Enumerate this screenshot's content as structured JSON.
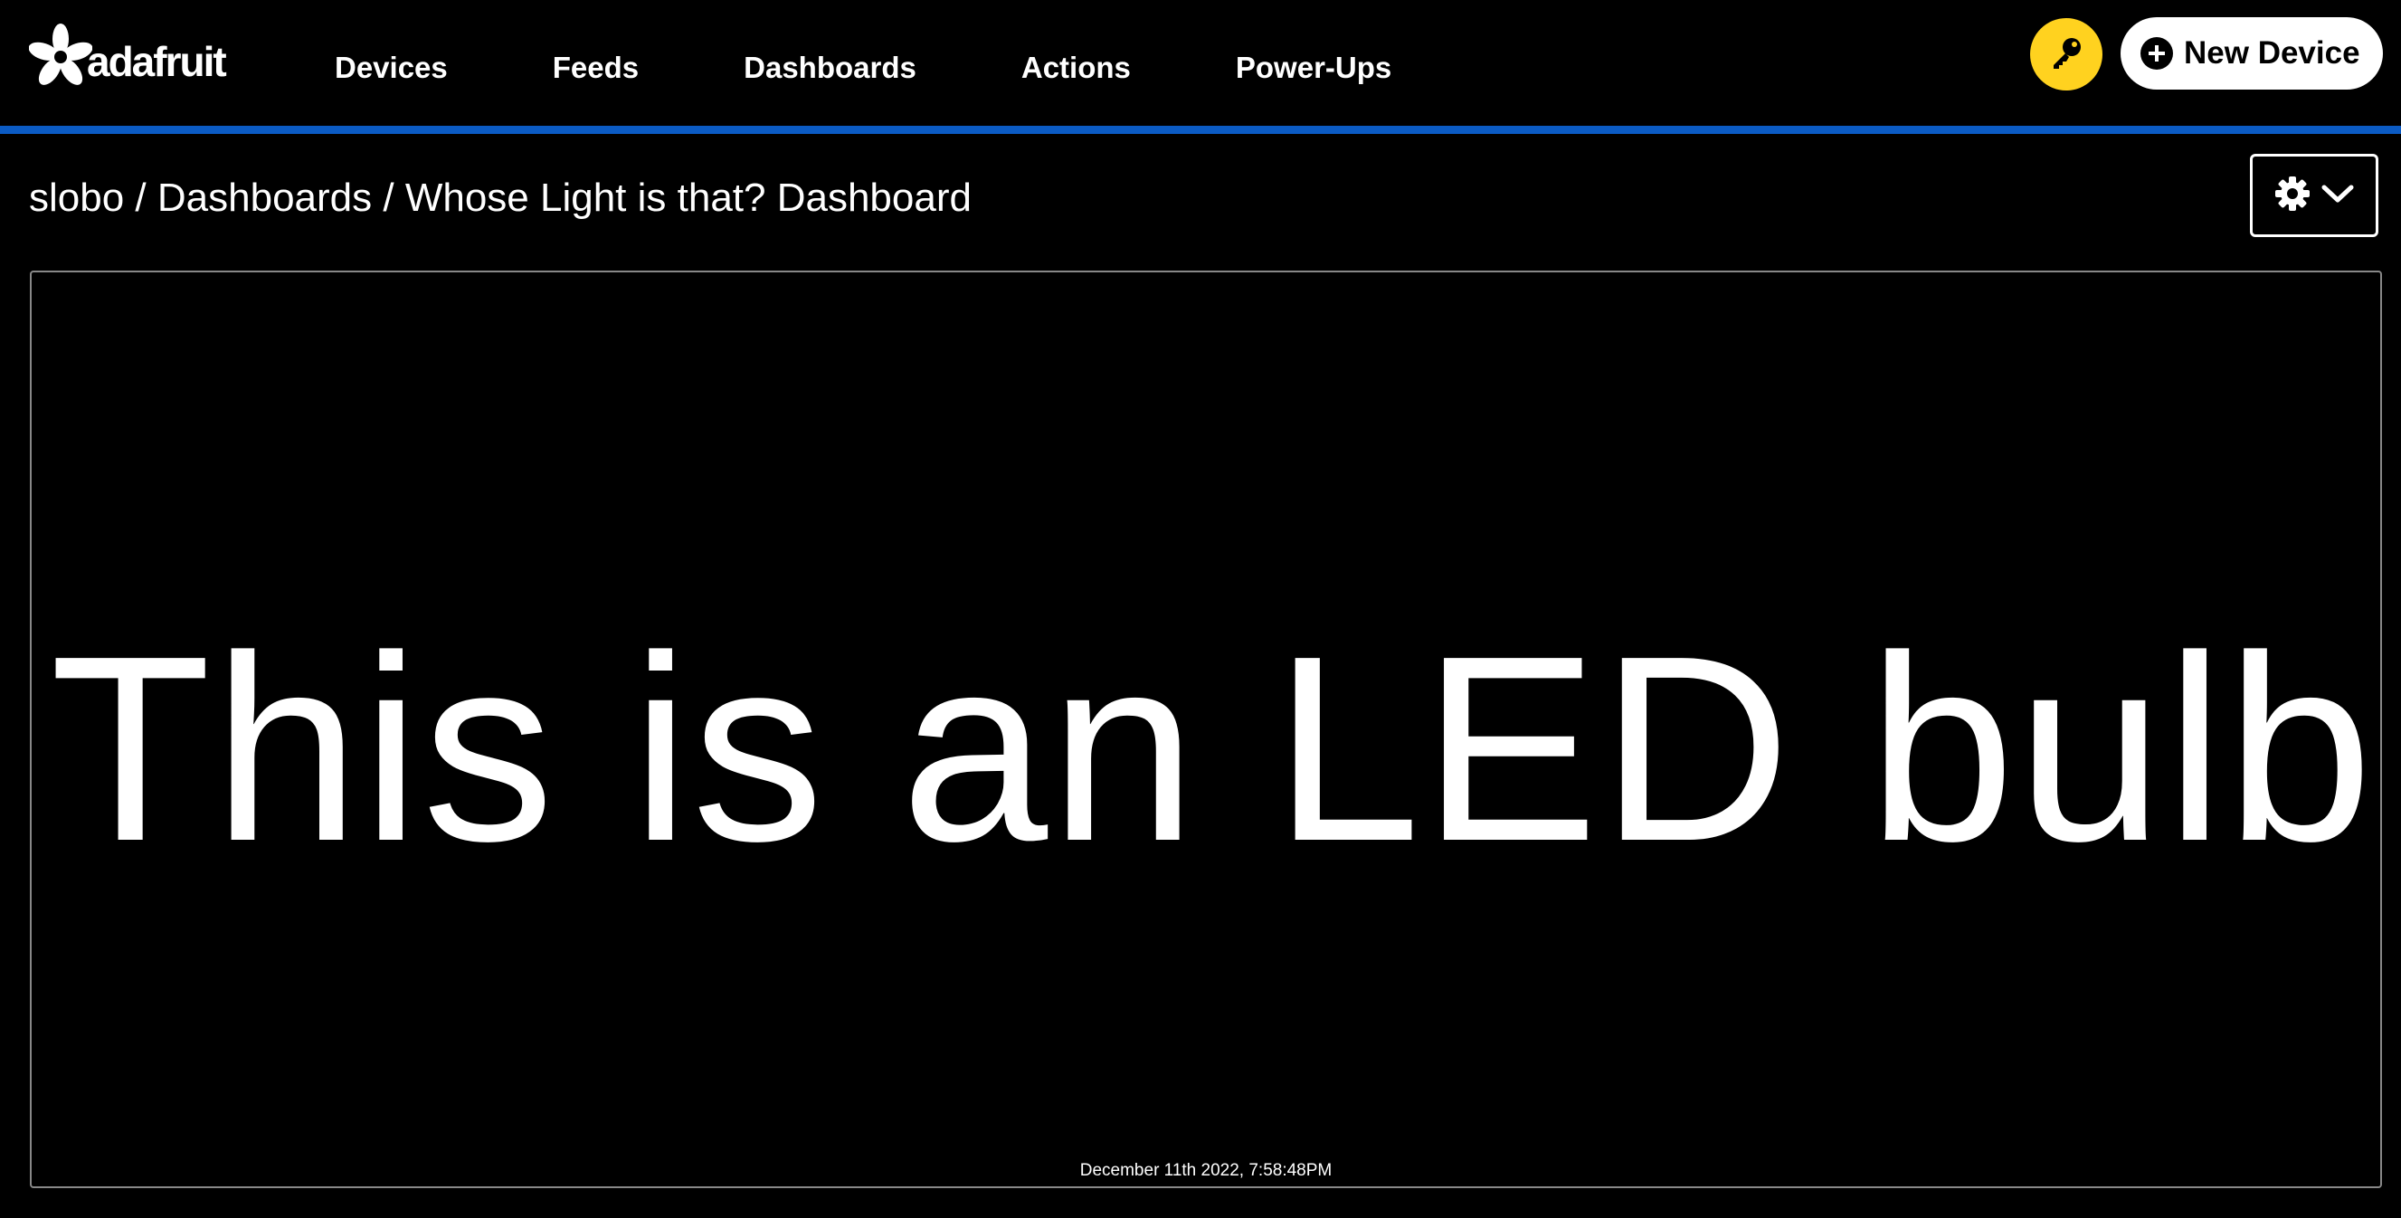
{
  "header": {
    "logo_text": "adafruit",
    "nav": [
      {
        "label": "Devices"
      },
      {
        "label": "Feeds"
      },
      {
        "label": "Dashboards"
      },
      {
        "label": "Actions"
      },
      {
        "label": "Power-Ups"
      }
    ],
    "key_icon": "key-icon",
    "new_device_label": "New Device"
  },
  "colors": {
    "accent_bar": "#0b5bc4",
    "key_button": "#ffd21f",
    "background": "#000000"
  },
  "breadcrumb": {
    "user": "slobo",
    "separator": " / ",
    "section": "Dashboards",
    "current": "Whose Light is that? Dashboard"
  },
  "settings": {
    "icon": "gear-icon",
    "dropdown_icon": "chevron-down-icon"
  },
  "block": {
    "text": "This is an LED bulb",
    "timestamp": "December 11th 2022, 7:58:48PM"
  }
}
